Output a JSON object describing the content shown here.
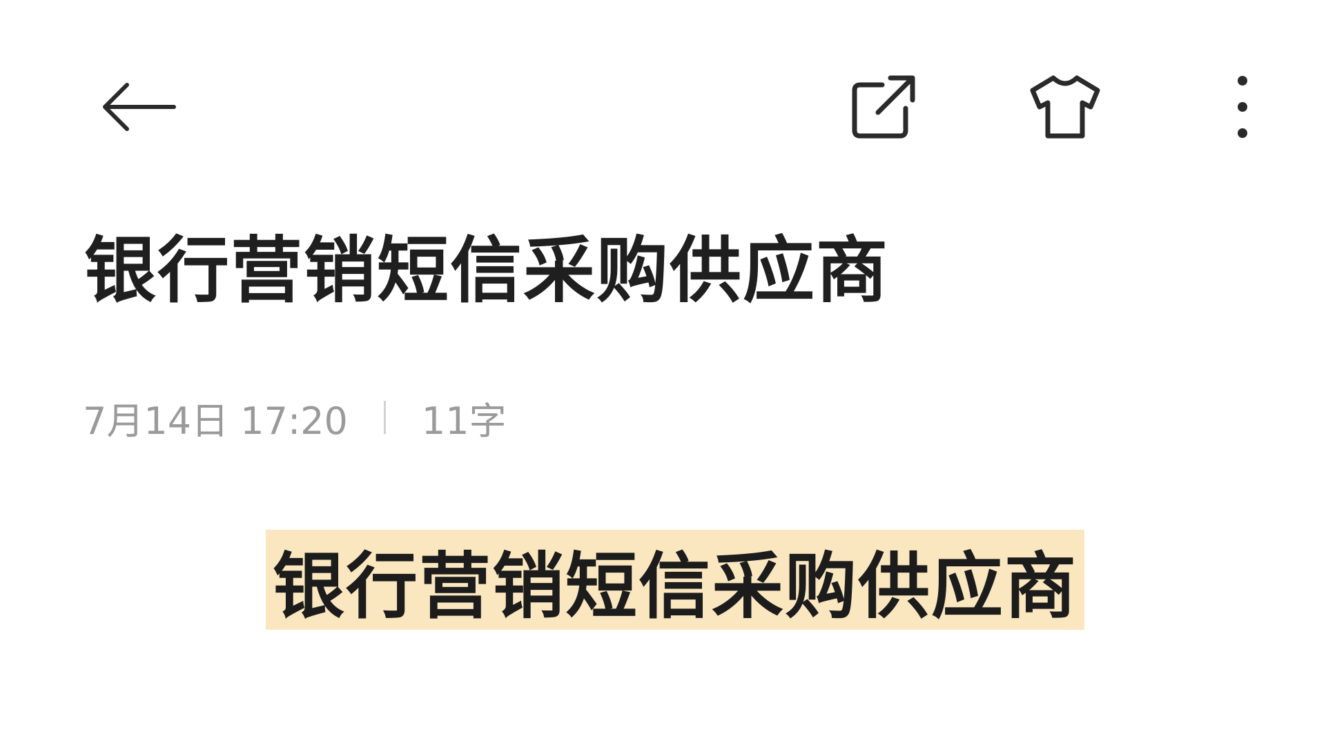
{
  "toolbar": {
    "back_icon": "arrow-left-icon",
    "share_icon": "share-external-icon",
    "theme_icon": "tshirt-icon",
    "more_icon": "more-vertical-icon"
  },
  "note": {
    "title": "银行营销短信采购供应商",
    "date": "7月14日 17:20",
    "word_count": "11字",
    "body_text": "银行营销短信采购供应商",
    "highlight_color": "#fbe7bf"
  }
}
